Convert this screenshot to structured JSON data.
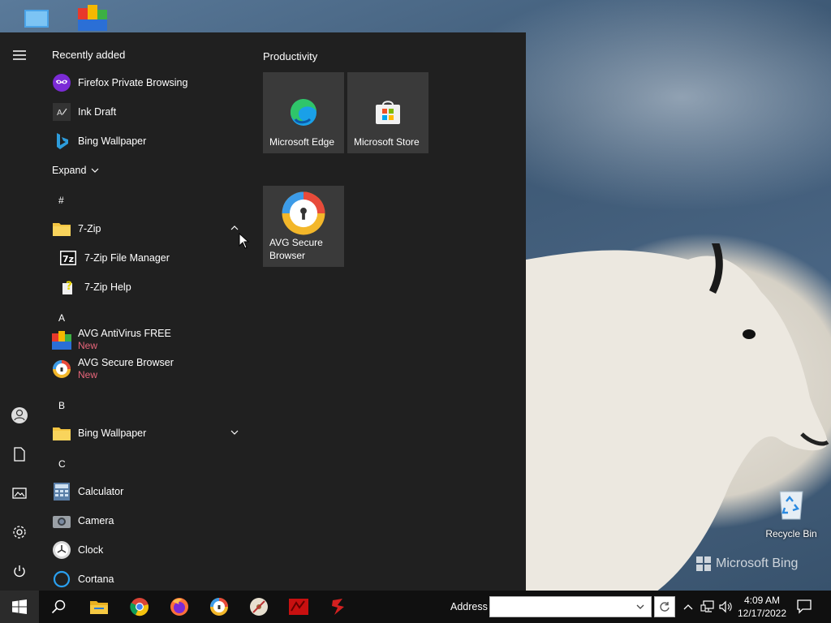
{
  "desktop": {
    "recycle_bin_label": "Recycle Bin",
    "watermark": "Microsoft Bing"
  },
  "start_menu": {
    "recently_added_header": "Recently added",
    "recent": [
      {
        "label": "Firefox Private Browsing",
        "icon": "firefox-private-icon"
      },
      {
        "label": "Ink Draft",
        "icon": "ink-draft-icon"
      },
      {
        "label": "Bing Wallpaper",
        "icon": "bing-icon"
      }
    ],
    "expand_label": "Expand",
    "section_hash": "#",
    "folder_7zip": "7-Zip",
    "sub_7zip_fm": "7-Zip File Manager",
    "sub_7zip_help": "7-Zip Help",
    "section_a": "A",
    "avg_antivirus": "AVG AntiVirus FREE",
    "avg_antivirus_badge": "New",
    "avg_browser": "AVG Secure Browser",
    "avg_browser_badge": "New",
    "section_b": "B",
    "folder_bing": "Bing Wallpaper",
    "section_c": "C",
    "calculator": "Calculator",
    "camera": "Camera",
    "clock": "Clock",
    "cortana": "Cortana",
    "tiles_header": "Productivity",
    "tiles": [
      {
        "label": "Microsoft Edge"
      },
      {
        "label": "Microsoft Store"
      },
      {
        "label": "AVG Secure Browser"
      }
    ]
  },
  "taskbar": {
    "address_label": "Address",
    "address_value": "",
    "time": "4:09 AM",
    "date": "12/17/2022"
  },
  "colors": {
    "start_bg": "#202020",
    "tile_bg": "#3a3a3a",
    "new_badge": "#e8657a",
    "taskbar_bg": "#101010"
  }
}
